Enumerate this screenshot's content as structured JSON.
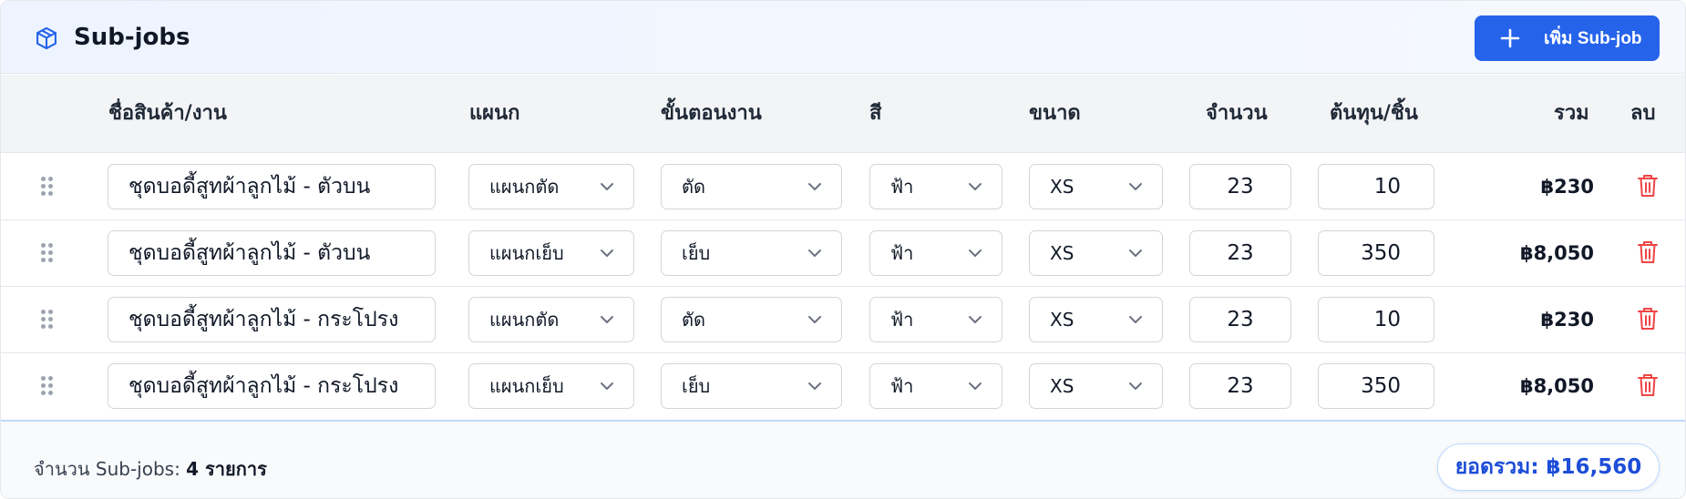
{
  "header": {
    "title": "Sub-jobs",
    "icon": "package-icon",
    "add_button_label": "เพิ่ม Sub-job",
    "accent_color": "#2563eb"
  },
  "columns": {
    "name": "ชื่อสินค้า/งาน",
    "department": "แผนก",
    "step": "ขั้นตอนงาน",
    "color": "สี",
    "size": "ขนาด",
    "quantity": "จำนวน",
    "unit_cost": "ต้นทุน/ชิ้น",
    "total": "รวม",
    "delete": "ลบ"
  },
  "rows": [
    {
      "name": "ชุดบอดี้สูทผ้าลูกไม้ - ตัวบน",
      "department": "แผนกตัด",
      "step": "ตัด",
      "color": "ฟ้า",
      "size": "XS",
      "quantity": "23",
      "unit_cost": "10",
      "total": "฿230"
    },
    {
      "name": "ชุดบอดี้สูทผ้าลูกไม้ - ตัวบน",
      "department": "แผนกเย็บ",
      "step": "เย็บ",
      "color": "ฟ้า",
      "size": "XS",
      "quantity": "23",
      "unit_cost": "350",
      "total": "฿8,050"
    },
    {
      "name": "ชุดบอดี้สูทผ้าลูกไม้ - กระโปรง",
      "department": "แผนกตัด",
      "step": "ตัด",
      "color": "ฟ้า",
      "size": "XS",
      "quantity": "23",
      "unit_cost": "10",
      "total": "฿230"
    },
    {
      "name": "ชุดบอดี้สูทผ้าลูกไม้ - กระโปรง",
      "department": "แผนกเย็บ",
      "step": "เย็บ",
      "color": "ฟ้า",
      "size": "XS",
      "quantity": "23",
      "unit_cost": "350",
      "total": "฿8,050"
    }
  ],
  "footer": {
    "count_label": "จำนวน Sub-jobs:",
    "count_value": "4 รายการ",
    "grand_total": "ยอดรวม: ฿16,560"
  },
  "colors": {
    "delete": "#ef4444",
    "grand_total": "#1d4ed8"
  }
}
